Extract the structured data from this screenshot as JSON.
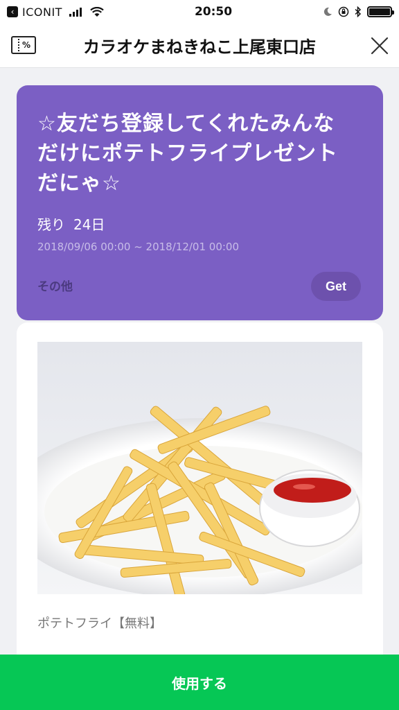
{
  "status_bar": {
    "back_app": "ICONIT",
    "time": "20:50"
  },
  "header": {
    "title": "カラオケまねきねこ上尾東口店",
    "coupon_icon_glyph": "%"
  },
  "coupon": {
    "title_line1": "☆友だち登録してくれたみんな",
    "title_line2": "だけにポテトフライプレゼント",
    "title_line3": "だにゃ☆",
    "remaining_label": "残り",
    "remaining_value": "24日",
    "period": "2018/09/06 00:00 ~ 2018/12/01 00:00",
    "category": "その他",
    "get_label": "Get",
    "color": "#7b5fc4"
  },
  "product": {
    "name": "ポテトフライ【無料】"
  },
  "footer": {
    "use_label": "使用する",
    "color": "#06c755"
  },
  "icons": {
    "back": "back-icon",
    "signal": "signal-icon",
    "wifi": "wifi-icon",
    "moon": "moon-icon",
    "lock": "lock-rotation-icon",
    "bluetooth": "bluetooth-icon",
    "battery": "battery-icon",
    "coupon": "coupon-icon",
    "close": "close-icon"
  }
}
